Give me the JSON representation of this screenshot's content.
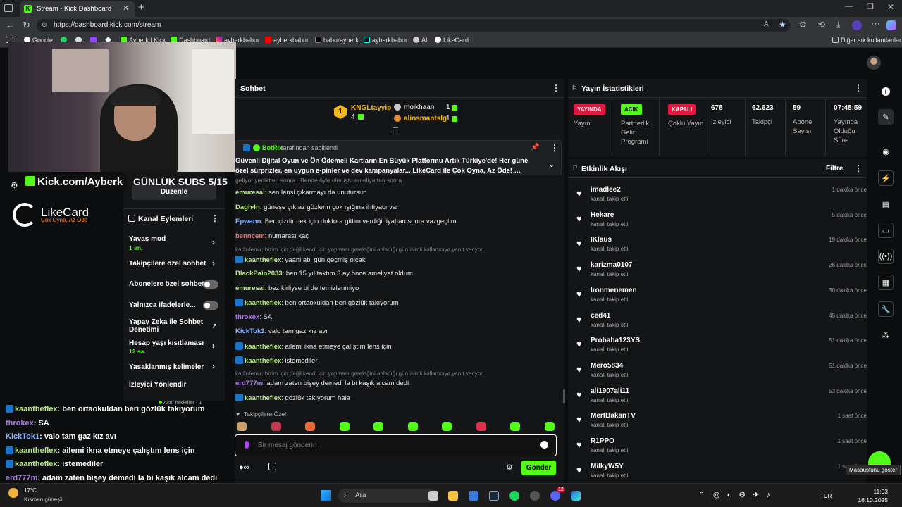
{
  "browser": {
    "tab_title": "Stream - Kick Dashboard",
    "url": "https://dashboard.kick.com/stream",
    "bookmarks": [
      "Google",
      "",
      "",
      "",
      "",
      "Ayberk | Kick",
      "Dashboard",
      "ayberkbabur",
      "ayberkbabur",
      "baburayberk",
      "ayberkbabur",
      "AI",
      "LikeCard"
    ],
    "other_bookmarks": "Diğer sık kullanılanlar"
  },
  "overlay": {
    "kick_url": "Kick.com/Ayberk",
    "subs_goal": "GÜNLÜK SUBS 5/15",
    "likecard_name": "LikeCard",
    "likecard_tagline": "Çok Oyna, Az Öde",
    "chat_lines": [
      {
        "user": "kaantheflex",
        "text": ": ben ortaokuldan beri gözlük takıyorum",
        "color": "#b8e986",
        "badge": true
      },
      {
        "user": "throkex",
        "text": ": SA",
        "color": "#a77be0",
        "badge": false
      },
      {
        "user": "KickTok1",
        "text": ": valo tam gaz kız avı",
        "color": "#7fb3ff",
        "badge": false
      },
      {
        "user": "kaantheflex",
        "text": ": ailemi ikna etmeye çalıştım lens için",
        "color": "#b8e986",
        "badge": true
      },
      {
        "user": "kaantheflex",
        "text": ": istemediler",
        "color": "#b8e986",
        "badge": true
      },
      {
        "user": "erd777m",
        "text": ": adam zaten bişey demedi la bi kaşık alcam dedi",
        "color": "#a77be0",
        "badge": false
      },
      {
        "user": "takıyorum hala",
        "text": "",
        "color": "#ffffff",
        "badge": false
      }
    ]
  },
  "channel_actions": {
    "title": "Kanal Eylemleri",
    "edit_label": "Düzenle",
    "items": [
      {
        "label": "Yavaş mod",
        "sub": "1 sn."
      },
      {
        "label": "Takipçilere özel sohbet",
        "sub": ""
      },
      {
        "label": "Abonelere özel sohbet",
        "sub": ""
      },
      {
        "label": "Yalnızca ifadelerle...",
        "sub": ""
      },
      {
        "label": "Yapay Zeka ile Sohbet Denetimi",
        "sub": ""
      },
      {
        "label": "Hesap yaşı kısıtlaması",
        "sub": "12 sa."
      },
      {
        "label": "Yasaklanmış kelimeler",
        "sub": ""
      },
      {
        "label": "İzleyici Yönlendir",
        "sub": ""
      }
    ],
    "goals_label": "Hedefl...",
    "active_goals": "Aktif hedefler - 1"
  },
  "chat": {
    "title": "Sohbet",
    "leaders": {
      "first": {
        "name": "KNGLtayyip",
        "count": "4"
      },
      "second": {
        "name": "moikhaan",
        "count": "1"
      },
      "third": {
        "name": "aliosmantslg",
        "count": "1"
      }
    },
    "pinned": {
      "by_user": "BotRix",
      "by_text": "tarafından sabitlendi",
      "text": "Güvenli Dijital Oyun ve Ön Ödemeli Kartların En Büyük Platformu Artık Türkiye'de! Her güne özel sürprizler, en uygun e-pinler ve dev kampanyalar... LikeCard ile Çok Oyna, Az Öde! …"
    },
    "partial_line": "geliyor yediktten sonra . Bende öyle olmuştu ameliyattan sonra",
    "messages": [
      {
        "user": "emuresai",
        "text": ": sen lensi çıkarmayı da unutursun",
        "color": "#b8e986",
        "badge": false,
        "reply": ""
      },
      {
        "user": "Dagh4n",
        "text": ": güneşe çık az gözlerin çok ışığına ihtiyacı var",
        "color": "#b8e986",
        "badge": false,
        "reply": ""
      },
      {
        "user": "Epwann",
        "text": ": Ben çizdirmek için doktora gittim verdiği fiyattan sonra vazgeçtim",
        "color": "#7fb3ff",
        "badge": false,
        "reply": ""
      },
      {
        "user": "benncem",
        "text": ": numarası kaç",
        "color": "#ff6b6b",
        "badge": false,
        "reply": ""
      },
      {
        "user": "kaantheflex",
        "text": ": yaani abi gün geçmiş olcak",
        "color": "#b8e986",
        "badge": true,
        "reply": "kadirdemir: bizim için değil kendi için yapması gerektğini anladığı gün isimli kullanıcıya yanıt veriyor"
      },
      {
        "user": "BlackPain2033",
        "text": ": ben 15 yıl taktım 3 ay önce ameliyat oldum",
        "color": "#b8e986",
        "badge": false,
        "reply": ""
      },
      {
        "user": "emuresai",
        "text": ": bez kirliyse bi de temizlenmiyo",
        "color": "#b8e986",
        "badge": false,
        "reply": ""
      },
      {
        "user": "kaantheflex",
        "text": ": ben ortaokuldan beri gözlük takıyorum",
        "color": "#b8e986",
        "badge": true,
        "reply": ""
      },
      {
        "user": "throkex",
        "text": ": SA",
        "color": "#a77be0",
        "badge": false,
        "reply": ""
      },
      {
        "user": "KickTok1",
        "text": ": valo tam gaz kız avı",
        "color": "#7fb3ff",
        "badge": false,
        "reply": ""
      },
      {
        "user": "kaantheflex",
        "text": ": ailemi ikna etmeye çalıştım lens için",
        "color": "#b8e986",
        "badge": true,
        "reply": ""
      },
      {
        "user": "kaantheflex",
        "text": ": istemediler",
        "color": "#b8e986",
        "badge": true,
        "reply": ""
      },
      {
        "user": "erd777m",
        "text": ": adam zaten bişey demedi la bi kaşık alcam dedi",
        "color": "#a77be0",
        "badge": false,
        "reply": "kadirdemir: bizim için değil kendi için yapması gerektğini anladığı gün isimli kullanıcıya yanıt veriyor"
      },
      {
        "user": "kaantheflex",
        "text": ": gözlük takıyorum hala",
        "color": "#b8e986",
        "badge": true,
        "reply": ""
      }
    ],
    "followers_only": "Takipçilere Özel",
    "input_placeholder": "Bir mesaj gönderin",
    "send_label": "Gönder"
  },
  "stats": {
    "title": "Yayın İstatistikleri",
    "items": [
      {
        "tag": "YAYINDA",
        "label": "Yayın"
      },
      {
        "tag": "ACIK",
        "label": "Partnerlik Gelir Programı"
      },
      {
        "tag": "KAPALI",
        "label": "Çoklu Yayın"
      },
      {
        "value": "678",
        "label": "İzleyici"
      },
      {
        "value": "62.623",
        "label": "Takipçi"
      },
      {
        "value": "59",
        "label": "Abone Sayısı"
      },
      {
        "value": "07:48:59",
        "label": "Yayında Olduğu Süre"
      }
    ]
  },
  "activity": {
    "title": "Etkinlik Akışı",
    "filter_label": "Filtre",
    "events": [
      {
        "name": "imadlee2",
        "action": "kanalı takip etti",
        "time": "1 dakika önce"
      },
      {
        "name": "Hekare",
        "action": "kanalı takip etti",
        "time": "5 dakika önce"
      },
      {
        "name": "IKlaus",
        "action": "kanalı takip etti",
        "time": "19 dakika önce"
      },
      {
        "name": "karizma0107",
        "action": "kanalı takip etti",
        "time": "26 dakika önce"
      },
      {
        "name": "Ironmenemen",
        "action": "kanalı takip etti",
        "time": "30 dakika önce"
      },
      {
        "name": "ced41",
        "action": "kanalı takip etti",
        "time": "45 dakika önce"
      },
      {
        "name": "Probaba123YS",
        "action": "kanalı takip etti",
        "time": "51 dakika önce"
      },
      {
        "name": "Mero5834",
        "action": "kanalı takip etti",
        "time": "51 dakika önce"
      },
      {
        "name": "ali1907ali11",
        "action": "kanalı takip etti",
        "time": "53 dakika önce"
      },
      {
        "name": "MertBakanTV",
        "action": "kanalı takip etti",
        "time": "1 saat önce"
      },
      {
        "name": "R1PPO",
        "action": "kanalı takip etti",
        "time": "1 saat önce"
      },
      {
        "name": "MilkyW5Y",
        "action": "kanalı takip etti",
        "time": "1 saat önce"
      }
    ]
  },
  "taskbar": {
    "weather_temp": "17°C",
    "weather_desc": "Kısmen güneşli",
    "search_label": "Ara",
    "lang": "TUR",
    "time": "11:03",
    "date": "16.10.2025",
    "desktop_tooltip": "Masaüstünü göster",
    "notification_count": "12"
  },
  "colors": {
    "kick_green": "#53fc18",
    "live_red": "#e5173f"
  }
}
